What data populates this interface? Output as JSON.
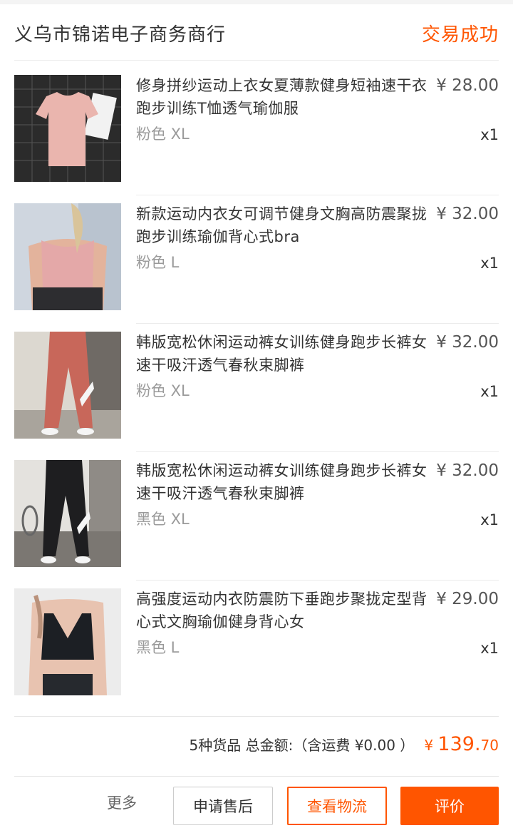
{
  "header": {
    "shop_name": "义乌市锦诺电子商务商行",
    "status": "交易成功"
  },
  "items": [
    {
      "title": "修身拼纱运动上衣女夏薄款健身短袖速干衣跑步训练T恤透气瑜伽服",
      "price": "¥ 28.00",
      "sku": "粉色 XL",
      "qty": "x1"
    },
    {
      "title": "新款运动内衣女可调节健身文胸高防震聚拢跑步训练瑜伽背心式bra",
      "price": "¥ 32.00",
      "sku": "粉色 L",
      "qty": "x1"
    },
    {
      "title": "韩版宽松休闲运动裤女训练健身跑步长裤女速干吸汗透气春秋束脚裤",
      "price": "¥ 32.00",
      "sku": "粉色 XL",
      "qty": "x1"
    },
    {
      "title": "韩版宽松休闲运动裤女训练健身跑步长裤女速干吸汗透气春秋束脚裤",
      "price": "¥ 32.00",
      "sku": "黑色 XL",
      "qty": "x1"
    },
    {
      "title": "高强度运动内衣防震防下垂跑步聚拢定型背心式文胸瑜伽健身背心女",
      "price": "¥ 29.00",
      "sku": "黑色 L",
      "qty": "x1"
    }
  ],
  "summary": {
    "text": "5种货品 总金额:（含运费 ¥0.00 ）",
    "currency": "¥",
    "total_major": "139.",
    "total_minor": "70"
  },
  "actions": {
    "more": "更多",
    "after_sale": "申请售后",
    "logistics": "查看物流",
    "review": "评价"
  },
  "colors": {
    "accent": "#ff5500"
  }
}
